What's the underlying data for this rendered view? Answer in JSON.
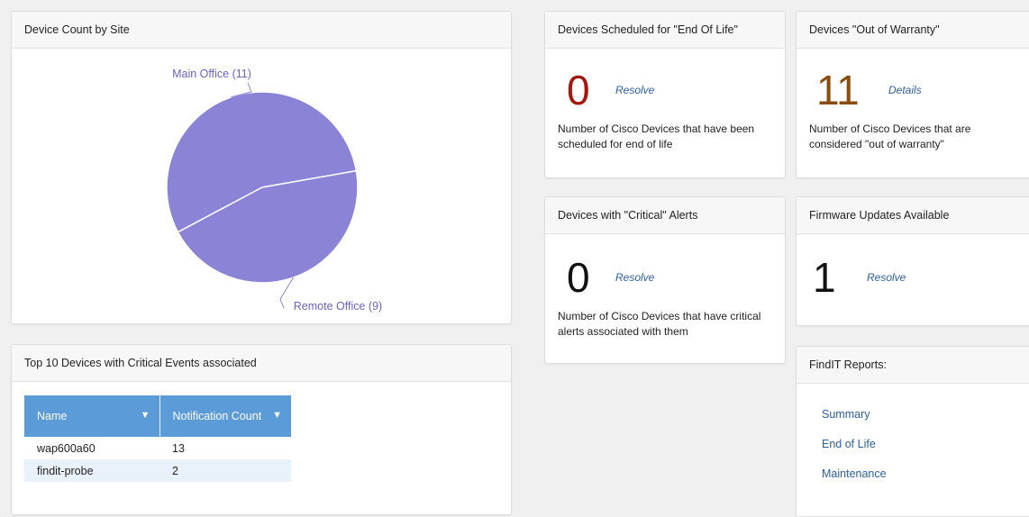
{
  "device_count_by_site": {
    "title": "Device Count by Site",
    "chart_data": {
      "type": "pie",
      "categories": [
        "Main Office",
        "Remote Office"
      ],
      "values": [
        11,
        9
      ],
      "labels": [
        "Main Office (11)",
        "Remote Office (9)"
      ],
      "colors": [
        "#8b84d6",
        "#8b84d6"
      ]
    }
  },
  "end_of_life": {
    "title": "Devices Scheduled for \"End Of Life\"",
    "count": "0",
    "link": "Resolve",
    "description": "Number of Cisco Devices that have been scheduled for end of life",
    "color": "#a3170f"
  },
  "out_of_warranty": {
    "title": "Devices \"Out of Warranty\"",
    "count": "11",
    "link": "Details",
    "description": "Number of Cisco Devices that are considered \"out of warranty\"",
    "color": "#8a4d0f"
  },
  "critical_alerts": {
    "title": "Devices with \"Critical\" Alerts",
    "count": "0",
    "link": "Resolve",
    "description": "Number of Cisco Devices that have critical alerts associated with them"
  },
  "firmware": {
    "title": "Firmware Updates Available",
    "count": "1",
    "link": "Resolve"
  },
  "top_devices": {
    "title": "Top 10 Devices with Critical Events associated",
    "columns": [
      "Name",
      "Notification Count"
    ],
    "rows": [
      [
        "wap600a60",
        "13"
      ],
      [
        "findit-probe",
        "2"
      ]
    ]
  },
  "reports": {
    "title": "FindIT Reports:",
    "items": [
      "Summary",
      "End of Life",
      "Maintenance"
    ]
  }
}
